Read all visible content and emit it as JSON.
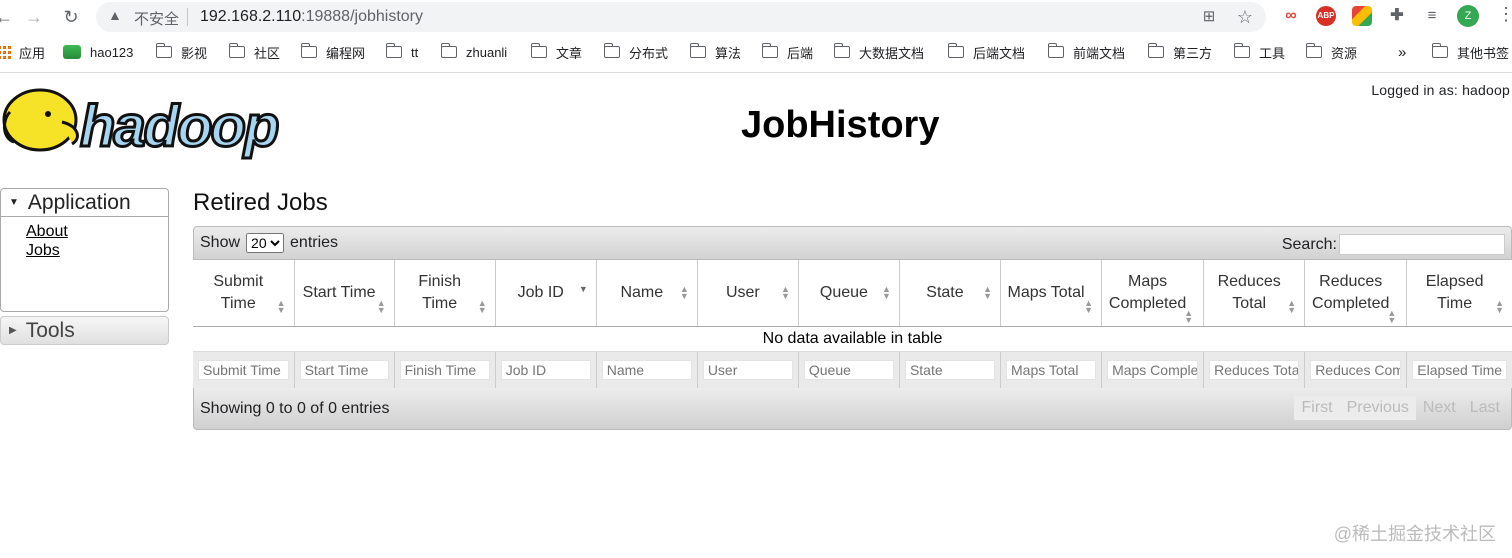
{
  "browser": {
    "security_label": "不安全",
    "url_host": "192.168.2.110",
    "url_rest": ":19888/jobhistory",
    "profile_initial": "Z",
    "ext_abp": "ABP",
    "bookmarks": [
      "应用",
      "hao123",
      "影视",
      "社区",
      "编程网",
      "tt",
      "zhuanli",
      "文章",
      "分布式",
      "算法",
      "后端",
      "大数据文档",
      "后端文档",
      "前端文档",
      "第三方",
      "工具",
      "资源"
    ],
    "bookmarks_overflow": "»",
    "other_bookmarks": "其他书签"
  },
  "header": {
    "logged_in": "Logged in as: hadoop",
    "title": "JobHistory",
    "logo_text": "hadoop"
  },
  "nav": {
    "application_label": "Application",
    "about_label": "About",
    "jobs_label": "Jobs",
    "tools_label": "Tools"
  },
  "main": {
    "title": "Retired Jobs",
    "show_label": "Show",
    "entries_label": "entries",
    "page_size": "20",
    "search_label": "Search:",
    "columns": [
      [
        "Submit",
        "Time"
      ],
      [
        "Start Time"
      ],
      [
        "Finish",
        "Time"
      ],
      [
        "Job ID"
      ],
      [
        "Name"
      ],
      [
        "User"
      ],
      [
        "Queue"
      ],
      [
        "State"
      ],
      [
        "Maps Total"
      ],
      [
        "Maps",
        "Completed"
      ],
      [
        "Reduces",
        "Total"
      ],
      [
        "Reduces",
        "Completed"
      ],
      [
        "Elapsed",
        "Time"
      ]
    ],
    "empty_message": "No data available in table",
    "filters": [
      "Submit Time",
      "Start Time",
      "Finish Time",
      "Job ID",
      "Name",
      "User",
      "Queue",
      "State",
      "Maps Total",
      "Maps Completed",
      "Reduces Total",
      "Reduces Completed",
      "Elapsed Time"
    ],
    "info": "Showing 0 to 0 of 0 entries",
    "pager": {
      "first": "First",
      "previous": "Previous",
      "next": "Next",
      "last": "Last"
    }
  },
  "watermark": "@稀土掘金技术社区"
}
